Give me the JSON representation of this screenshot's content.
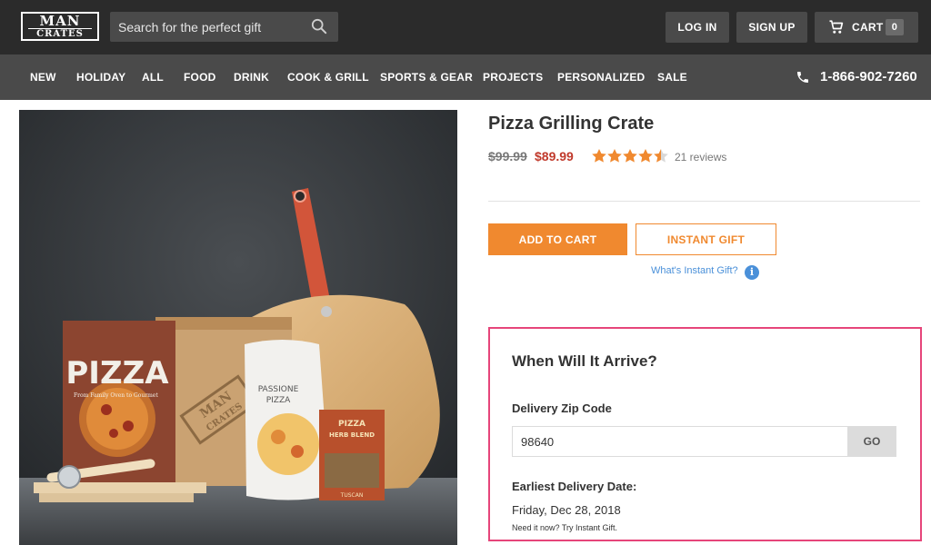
{
  "header": {
    "logo_line1": "MAN",
    "logo_line2": "CRATES",
    "search_placeholder": "Search for the perfect gift",
    "login_label": "LOG IN",
    "signup_label": "SIGN UP",
    "cart_label": "CART",
    "cart_count": "0"
  },
  "nav": {
    "items": [
      "NEW",
      "HOLIDAY",
      "ALL",
      "FOOD",
      "DRINK",
      "COOK & GRILL",
      "SPORTS & GEAR",
      "PROJECTS",
      "PERSONALIZED",
      "SALE"
    ],
    "phone": "1-866-902-7260"
  },
  "product": {
    "title": "Pizza Grilling Crate",
    "price_original": "$99.99",
    "price_sale": "$89.99",
    "rating": 4.5,
    "rating_max": 5,
    "reviews": "21 reviews",
    "add_to_cart_label": "ADD TO CART",
    "instant_gift_label": "INSTANT GIFT",
    "what_instant_link": "What's Instant Gift?",
    "image_texts": {
      "book_title": "PIZZA",
      "book_subtitle": "From Family Oven to Gourmet",
      "bag_label_line1": "PASSIONE",
      "bag_label_line2": "PIZZA",
      "box_line1": "PIZZA",
      "box_line2": "HERB BLEND",
      "box_footer": "TUSCAN",
      "crate_line1": "MAN",
      "crate_line2": "CRATES"
    }
  },
  "delivery": {
    "title": "When Will It Arrive?",
    "zip_label": "Delivery Zip Code",
    "zip_value": "98640",
    "go_label": "GO",
    "earliest_label": "Earliest Delivery Date:",
    "earliest_date": "Friday, Dec 28, 2018",
    "note": "Need it now? Try Instant Gift."
  },
  "colors": {
    "topbar": "#2b2b2b",
    "navbar": "#4a4a4a",
    "accent_orange": "#f0892f",
    "sale_red": "#c0392b",
    "link_blue": "#4a90d9",
    "highlight_pink": "#e6457a"
  },
  "icons": {
    "search": "search-icon",
    "cart": "cart-icon",
    "phone": "phone-icon",
    "info": "info-icon",
    "star": "star-icon"
  }
}
